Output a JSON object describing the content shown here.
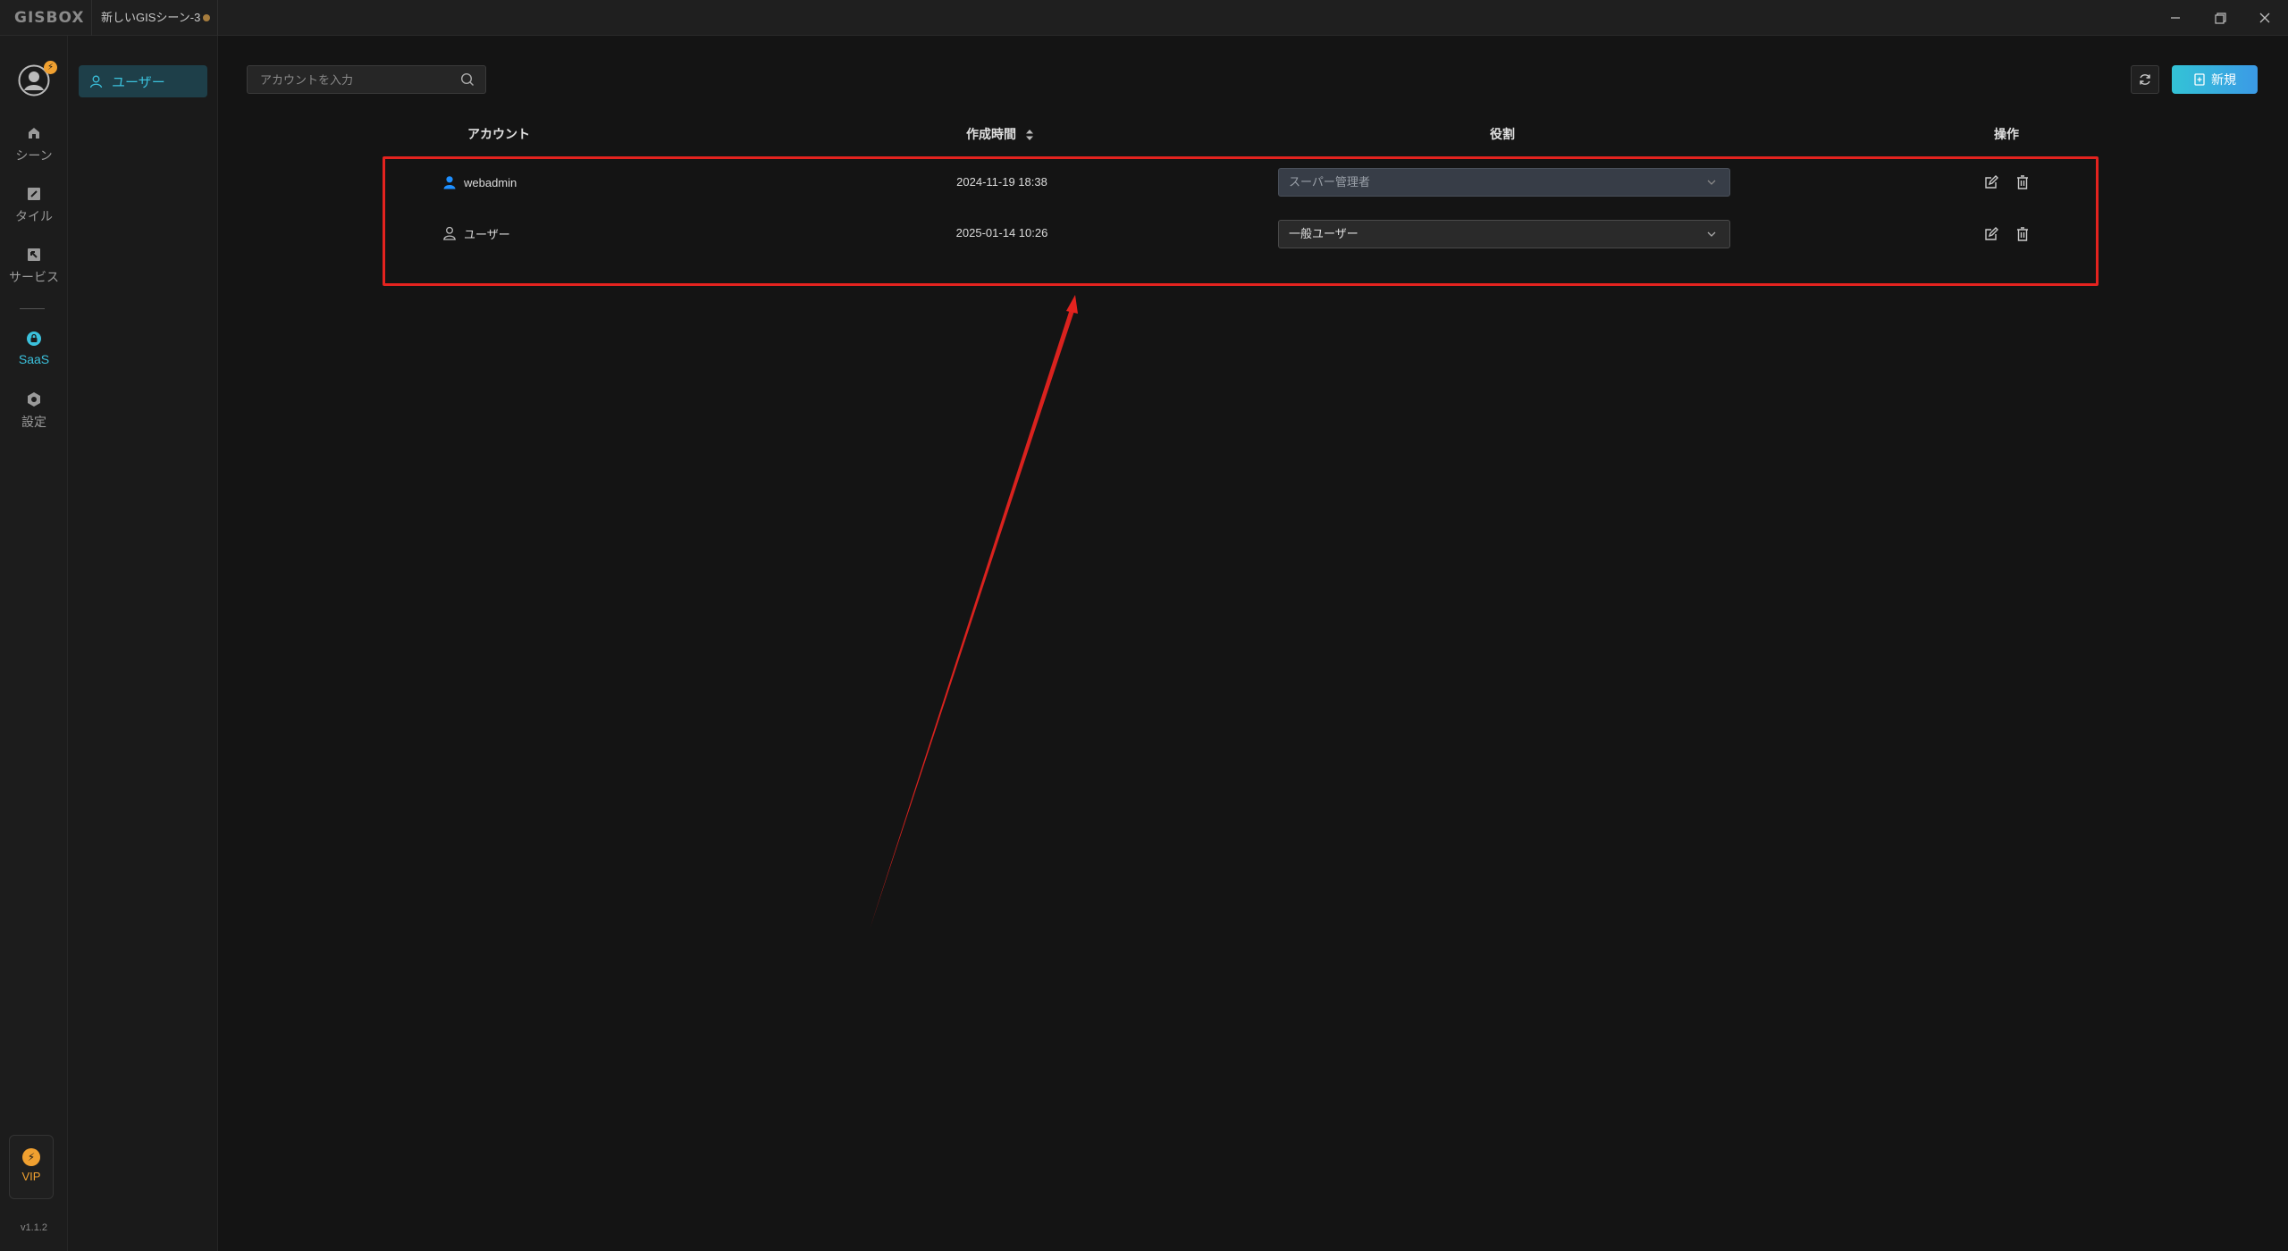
{
  "app": {
    "logo": "GISBOX",
    "doc_tab": "新しいGISシーン-3",
    "version": "v1.1.2",
    "avatar_badge": "⚡"
  },
  "rail": {
    "items": [
      {
        "label": "シーン",
        "icon": "scene-icon"
      },
      {
        "label": "タイル",
        "icon": "tile-icon"
      },
      {
        "label": "サービス",
        "icon": "service-icon"
      },
      {
        "label": "SaaS",
        "icon": "saas-icon",
        "active": true
      },
      {
        "label": "設定",
        "icon": "settings-icon"
      }
    ],
    "vip_label": "VIP",
    "vip_icon": "⚡"
  },
  "subnav": {
    "items": [
      {
        "label": "ユーザー",
        "icon": "user-icon",
        "active": true
      }
    ]
  },
  "toolbar": {
    "search_placeholder": "アカウントを入力",
    "new_label": "新規"
  },
  "table": {
    "headers": {
      "account": "アカウント",
      "created": "作成時間",
      "role": "役割",
      "actions": "操作"
    },
    "rows": [
      {
        "account": "webadmin",
        "created": "2024-11-19 18:38",
        "role": "スーパー管理者",
        "role_disabled": true,
        "icon_color": "#1e8fff"
      },
      {
        "account": "ユーザー",
        "created": "2025-01-14 10:26",
        "role": "一般ユーザー",
        "role_disabled": false,
        "icon_color": "#bbbbbb"
      }
    ]
  },
  "colors": {
    "accent": "#3bc1dc",
    "highlight_box": "#e4231f",
    "annotation_arrow": "#e4231f",
    "vip": "#f0a030"
  }
}
